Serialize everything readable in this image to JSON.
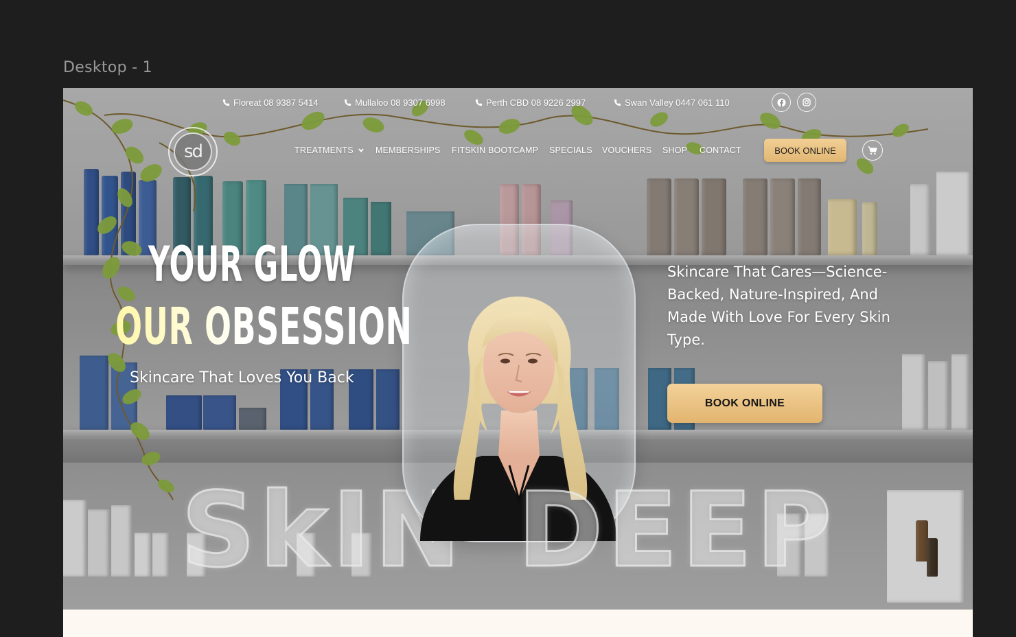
{
  "frame": {
    "label": "Desktop - 1"
  },
  "contact_bar": {
    "locations": [
      {
        "label": "Floreat 08 9387 5414"
      },
      {
        "label": "Mullaloo 08 9307 6998"
      },
      {
        "label": "Perth CBD 08 9226 2997"
      },
      {
        "label": "Swan Valley 0447 061 110"
      }
    ],
    "social": [
      {
        "icon": "facebook-icon"
      },
      {
        "icon": "instagram-icon"
      }
    ]
  },
  "logo": {
    "text": "sd"
  },
  "nav": {
    "items": [
      {
        "label": "TREATMENTS"
      },
      {
        "label": "MEMBERSHIPS"
      },
      {
        "label": "FITSKIN BOOTCAMP"
      },
      {
        "label": "SPECIALS"
      },
      {
        "label": "VOUCHERS"
      },
      {
        "label": "SHOP"
      },
      {
        "label": "CONTACT"
      }
    ],
    "book_label": "BOOK ONLINE",
    "cart_icon": "cart-icon"
  },
  "hero": {
    "headline_line1": "YOUR GLOW",
    "headline_line2": "OUR OBSESSION",
    "tagline": "Skincare That Loves You Back",
    "right_copy": "Skincare That Cares—Science-Backed, Nature-Inspired, And Made With Love For Every Skin Type.",
    "book_label": "BOOK ONLINE",
    "big_word_1": "SkIN",
    "big_word_2": "DEEP"
  },
  "colors": {
    "accent_gold": "#e8c184",
    "canvas_bg": "#1e1e1e",
    "page_bg": "#fdf8f2"
  }
}
